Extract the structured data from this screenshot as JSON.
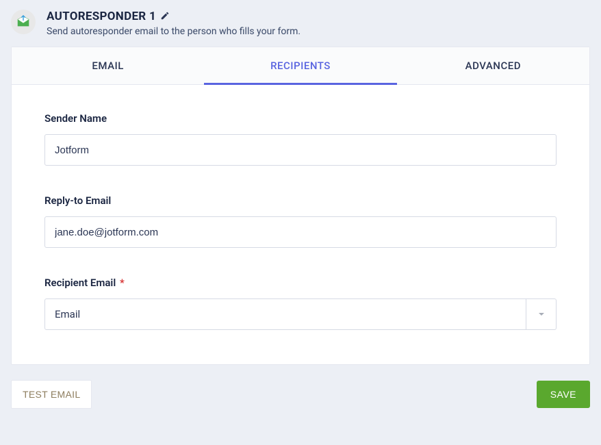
{
  "header": {
    "title": "AUTORESPONDER 1",
    "subtitle": "Send autoresponder email to the person who fills your form."
  },
  "tabs": {
    "email": "EMAIL",
    "recipients": "RECIPIENTS",
    "advanced": "ADVANCED"
  },
  "fields": {
    "senderName": {
      "label": "Sender Name",
      "value": "Jotform"
    },
    "replyTo": {
      "label": "Reply-to Email",
      "value": "jane.doe@jotform.com"
    },
    "recipientEmail": {
      "label": "Recipient Email",
      "value": "Email",
      "requiredMark": "*"
    }
  },
  "buttons": {
    "test": "TEST EMAIL",
    "save": "SAVE"
  }
}
